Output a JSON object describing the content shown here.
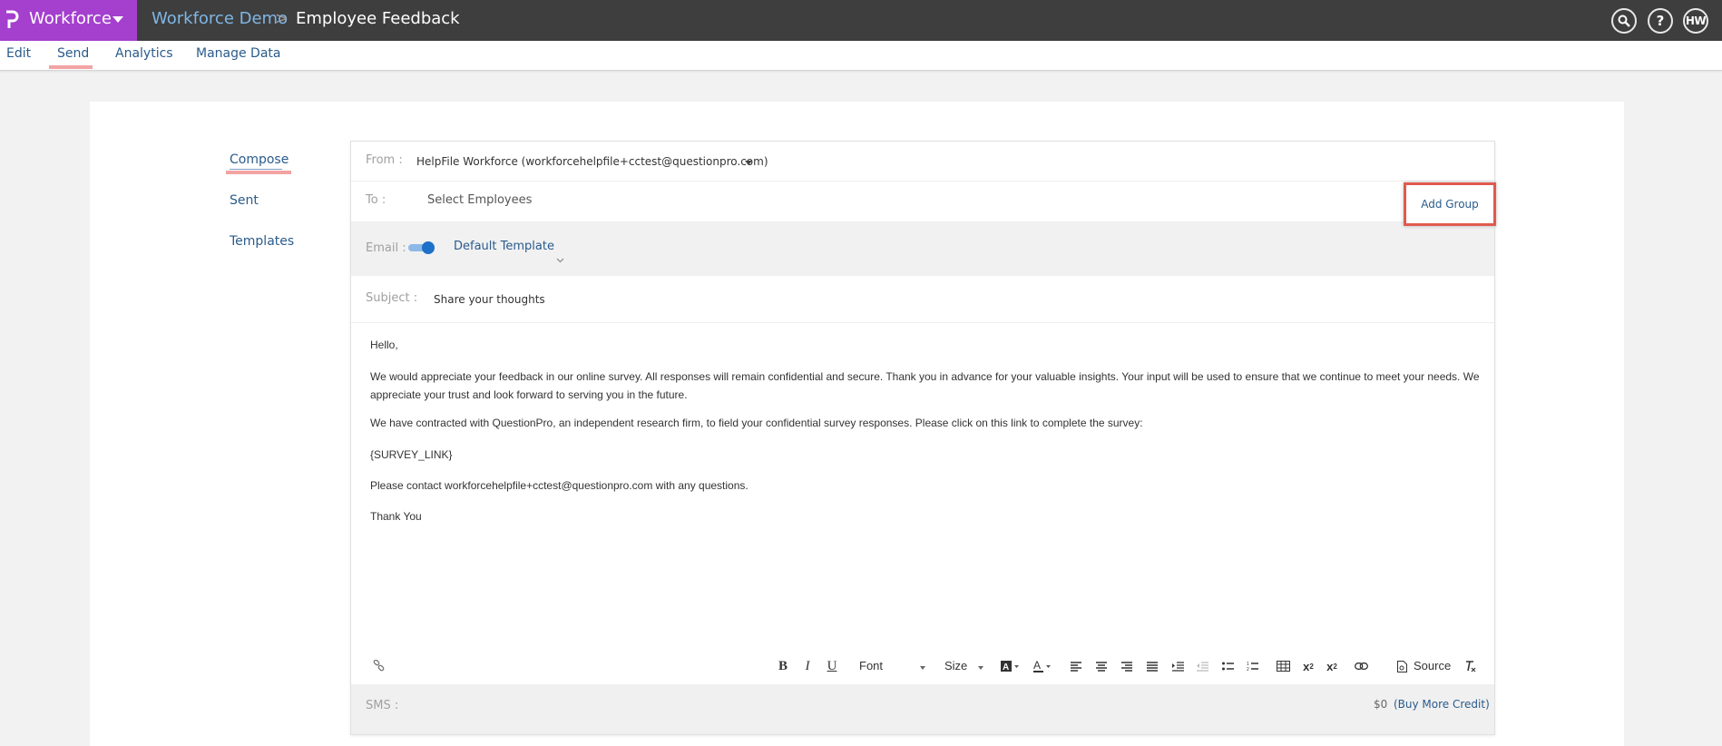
{
  "app": {
    "name": "Workforce",
    "breadcrumb": [
      "Workforce Demo",
      "Employee Feedback"
    ],
    "breadcrumb_separator": ">",
    "avatar_initials": "HW",
    "help_label": "?"
  },
  "subnav": {
    "items": [
      "Edit",
      "Send",
      "Analytics",
      "Manage Data"
    ],
    "active": "Send"
  },
  "leftnav": {
    "items": [
      "Compose",
      "Sent",
      "Templates"
    ],
    "active": "Compose"
  },
  "email_form": {
    "from_label": "From :",
    "from_value": "HelpFile Workforce (workforcehelpfile+cctest@questionpro.com)",
    "to_label": "To :",
    "to_placeholder": "Select Employees",
    "add_group_label": "Add Group",
    "email_label": "Email :",
    "email_toggle_on": true,
    "template_value": "Default Template",
    "subject_label": "Subject :",
    "subject_value": "Share your thoughts",
    "body": [
      "Hello,",
      "We would appreciate your feedback in our online survey. All responses will remain confidential and secure. Thank you in advance for your valuable insights. Your input will be used to ensure that we continue to meet your needs. We appreciate your trust and look forward to serving you in the future.",
      "We have contracted with QuestionPro, an independent research firm, to field your confidential survey responses. Please click on this link to complete the survey:",
      "{SURVEY_LINK}",
      "Please contact workforcehelpfile+cctest@questionpro.com with any questions.",
      "Thank You"
    ],
    "toolbar": {
      "font_label": "Font",
      "size_label": "Size",
      "source_label": "Source"
    },
    "sms_label": "SMS :",
    "credit_value": "$0",
    "buy_credit_label": "(Buy More Credit)"
  },
  "colors": {
    "topbar": "#3e3e3e",
    "brand": "#a43fce",
    "link": "#2a5b8c",
    "highlight_border": "#e05a4e",
    "underline_highlight": "#f2a3a3"
  }
}
